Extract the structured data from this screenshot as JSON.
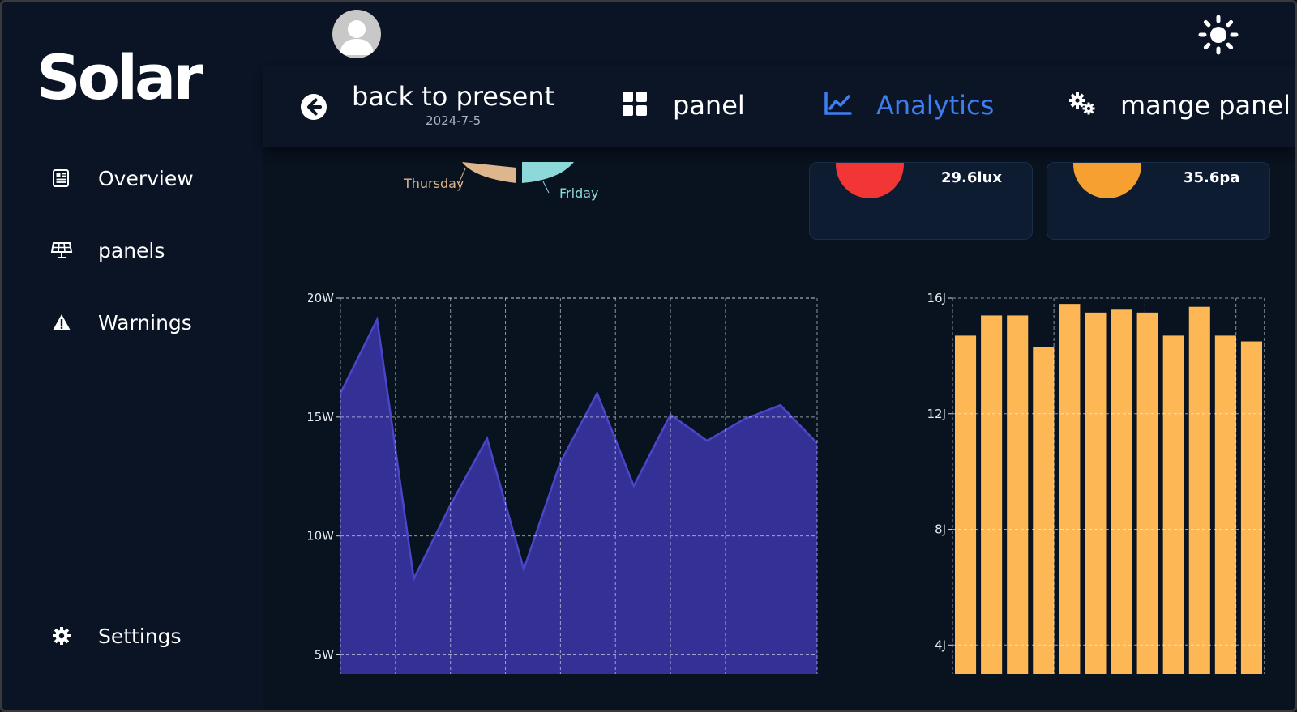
{
  "app": {
    "logo": "Solar"
  },
  "sidebar": {
    "items": [
      {
        "label": "Overview",
        "icon": "newspaper-icon"
      },
      {
        "label": "panels",
        "icon": "solar-panel-icon"
      },
      {
        "label": "Warnings",
        "icon": "warning-icon"
      },
      {
        "label": "Settings",
        "icon": "gear-icon"
      }
    ]
  },
  "header": {
    "avatar_icon": "user-avatar-icon",
    "theme_icon": "sun-icon"
  },
  "tabs": {
    "back": {
      "label": "back to present",
      "date": "2024-7-5",
      "icon": "arrow-left-circle-icon"
    },
    "panel": {
      "label": "panel",
      "icon": "grid-icon"
    },
    "analytics": {
      "label": "Analytics",
      "icon": "chart-line-icon",
      "active": true,
      "color": "#3d7ff0"
    },
    "manage": {
      "label": "mange panel",
      "icon": "gears-icon"
    }
  },
  "pie": {
    "labels": [
      "Thursday",
      "Friday"
    ],
    "colors": [
      "#deb68e",
      "#8dd8d8"
    ]
  },
  "cards": [
    {
      "value": "29.6",
      "unit": "lux",
      "color": "#f23535"
    },
    {
      "value": "35.6",
      "unit": "pa",
      "color": "#f5a030"
    }
  ],
  "chart_data": [
    {
      "type": "area",
      "series": [
        {
          "values": [
            16,
            19.1,
            8.2,
            11.3,
            14.1,
            8.6,
            13.1,
            16,
            12.1,
            15.1,
            14,
            14.9,
            15.5,
            13.9
          ]
        }
      ],
      "ylim": [
        4.2,
        20
      ],
      "yticks": [
        5,
        10,
        15,
        20
      ],
      "ytick_labels": [
        "5W",
        "10W",
        "15W",
        "20W"
      ],
      "color": "#343096",
      "line_color": "#4a46c8",
      "grid": true
    },
    {
      "type": "bar",
      "values": [
        14.7,
        15.4,
        15.4,
        14.3,
        15.8,
        15.5,
        15.6,
        15.5,
        14.7,
        15.7,
        14.7,
        14.5
      ],
      "ylim": [
        3,
        16
      ],
      "yticks": [
        4,
        8,
        12,
        16
      ],
      "ytick_labels": [
        "4J",
        "8J",
        "12J",
        "16J"
      ],
      "color": "#fdb754",
      "grid": true
    }
  ]
}
